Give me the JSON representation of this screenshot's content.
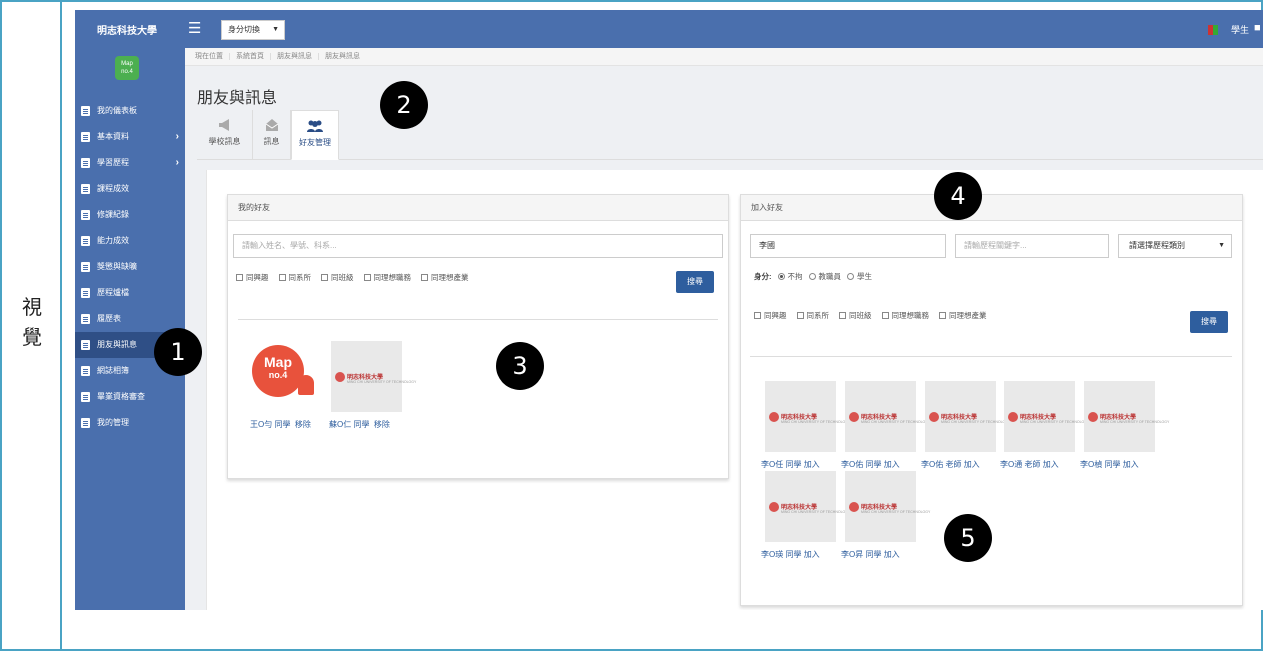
{
  "side_label": {
    "char1": "視",
    "char2": "覺"
  },
  "topbar": {
    "brand": "明志科技大學",
    "identity_select": "身分切換",
    "user_label": "學生"
  },
  "sidebar": {
    "logo_text": "Map no.4",
    "items": [
      {
        "label": "我的儀表板",
        "arrow": false
      },
      {
        "label": "基本資料",
        "arrow": true
      },
      {
        "label": "學習歷程",
        "arrow": true
      },
      {
        "label": "課程成效",
        "arrow": false
      },
      {
        "label": "修課紀錄",
        "arrow": false
      },
      {
        "label": "能力成效",
        "arrow": false
      },
      {
        "label": "獎懲與缺曠",
        "arrow": false
      },
      {
        "label": "歷程爐檔",
        "arrow": false
      },
      {
        "label": "履歷表",
        "arrow": false
      },
      {
        "label": "朋友與訊息",
        "arrow": false,
        "active": true
      },
      {
        "label": "網誌相簿",
        "arrow": false
      },
      {
        "label": "畢業資格審查",
        "arrow": false
      },
      {
        "label": "我的管理",
        "arrow": false
      }
    ]
  },
  "breadcrumb": [
    "現在位置",
    "系統首頁",
    "朋友與訊息",
    "朋友與訊息"
  ],
  "page_title": "朋友與訊息",
  "tabs": [
    {
      "label": "學校訊息",
      "icon": "megaphone-icon"
    },
    {
      "label": "訊息",
      "icon": "envelope-icon"
    },
    {
      "label": "好友管理",
      "icon": "users-icon",
      "active": true
    }
  ],
  "my_friends": {
    "title": "我的好友",
    "search_placeholder": "請輸入姓名、學號、科系...",
    "filters": [
      "同興趣",
      "同系所",
      "同班級",
      "同理想職務",
      "同理想產業"
    ],
    "search_button": "搜尋",
    "friends": [
      {
        "name": "王O勻 同學",
        "action": "移除",
        "avatar": "map-logo"
      },
      {
        "name": "蘇O仁 同學",
        "action": "移除",
        "avatar": "school-logo"
      }
    ]
  },
  "add_friends": {
    "title": "加入好友",
    "name_value": "李國",
    "keyword_placeholder": "請輸歷程關鍵字...",
    "category_select": "請選擇歷程類別",
    "identity_label": "身分:",
    "identity_options": [
      {
        "label": "不拘",
        "checked": true
      },
      {
        "label": "教職員",
        "checked": false
      },
      {
        "label": "學生",
        "checked": false
      }
    ],
    "filters": [
      "同興趣",
      "同系所",
      "同班級",
      "同理想職務",
      "同理想產業"
    ],
    "search_button": "搜尋",
    "results": [
      {
        "name": "李O任 同學",
        "action": "加入"
      },
      {
        "name": "李O佑 同學",
        "action": "加入"
      },
      {
        "name": "李O佑 老師",
        "action": "加入"
      },
      {
        "name": "李O通 老師",
        "action": "加入"
      },
      {
        "name": "李O楨 同學",
        "action": "加入"
      },
      {
        "name": "李O瑛 同學",
        "action": "加入"
      },
      {
        "name": "李O昇 同學",
        "action": "加入"
      }
    ]
  },
  "school_logo_text": "明志科技大學",
  "school_logo_sub": "MING CHI UNIVERSITY OF TECHNOLOGY",
  "badges": [
    "1",
    "2",
    "3",
    "4",
    "5"
  ],
  "colors": {
    "topbar": "#4a6fad",
    "sidebar": "#4a6fad",
    "active_item": "#2f4f86",
    "button": "#2e5e9e",
    "frame": "#4aa3c4",
    "badge": "#000000"
  }
}
